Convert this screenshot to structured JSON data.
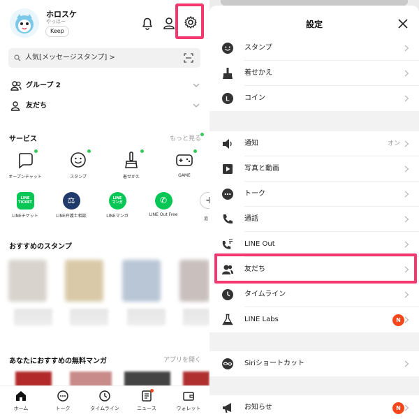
{
  "profile": {
    "name": "ホロスケ",
    "status": "やっほー",
    "keep_label": "Keep"
  },
  "search": {
    "text": "人気[メッセージスタンプ] >"
  },
  "rows": {
    "groups": "グループ 2",
    "friends": "友だち"
  },
  "services": {
    "title": "サービス",
    "more": "もっと見る",
    "items": [
      {
        "label": "オープンチャット",
        "icon": "open-chat-icon"
      },
      {
        "label": "スタンプ",
        "icon": "smiley-icon"
      },
      {
        "label": "着せかえ",
        "icon": "brush-icon"
      },
      {
        "label": "GAME",
        "icon": "gamepad-icon"
      }
    ],
    "apps": [
      {
        "label": "LINEチケット",
        "badge": "LINE\nTICKET",
        "color": "#06c755"
      },
      {
        "label": "LINE弁護士相談",
        "badge": "⚖",
        "color": "#1f3a6b"
      },
      {
        "label": "LINEマンガ",
        "badge": "LINE\nマンガ",
        "color": "#06c755"
      },
      {
        "label": "LINE Out Free",
        "badge": "✆",
        "color": "#06c755"
      }
    ],
    "partial_label": "追"
  },
  "stickers": {
    "title": "おすすめのスタンプ"
  },
  "manga": {
    "title": "あなたにおすすめの無料マンガ",
    "more": "アプリを開く"
  },
  "bottom_nav": [
    {
      "label": "ホーム",
      "icon": "home-icon"
    },
    {
      "label": "トーク",
      "icon": "chat-bubble-icon"
    },
    {
      "label": "タイムライン",
      "icon": "clock-icon"
    },
    {
      "label": "ニュース",
      "icon": "news-icon"
    },
    {
      "label": "ウォレット",
      "icon": "wallet-icon"
    }
  ],
  "settings": {
    "title": "設定",
    "items": [
      {
        "label": "スタンプ",
        "icon": "smiley-icon"
      },
      {
        "label": "着せかえ",
        "icon": "brush-icon"
      },
      {
        "label": "コイン",
        "icon": "coin-icon"
      },
      {
        "label": "通知",
        "icon": "speaker-icon",
        "value": "オン"
      },
      {
        "label": "写真と動画",
        "icon": "play-icon"
      },
      {
        "label": "トーク",
        "icon": "chat-bubble-icon"
      },
      {
        "label": "通話",
        "icon": "phone-icon"
      },
      {
        "label": "LINE Out",
        "icon": "phone-out-icon"
      },
      {
        "label": "友だち",
        "icon": "friends-icon"
      },
      {
        "label": "タイムライン",
        "icon": "clock-icon"
      },
      {
        "label": "LINE Labs",
        "icon": "flask-icon",
        "badge": "N"
      },
      {
        "label": "Siriショートカット",
        "icon": "siri-icon"
      },
      {
        "label": "お知らせ",
        "icon": "megaphone-icon",
        "badge": "N"
      }
    ]
  },
  "colors": {
    "highlight": "#f2386f",
    "line_green": "#06c755",
    "badge_orange": "#f7471a",
    "dot_green": "#34c759"
  }
}
